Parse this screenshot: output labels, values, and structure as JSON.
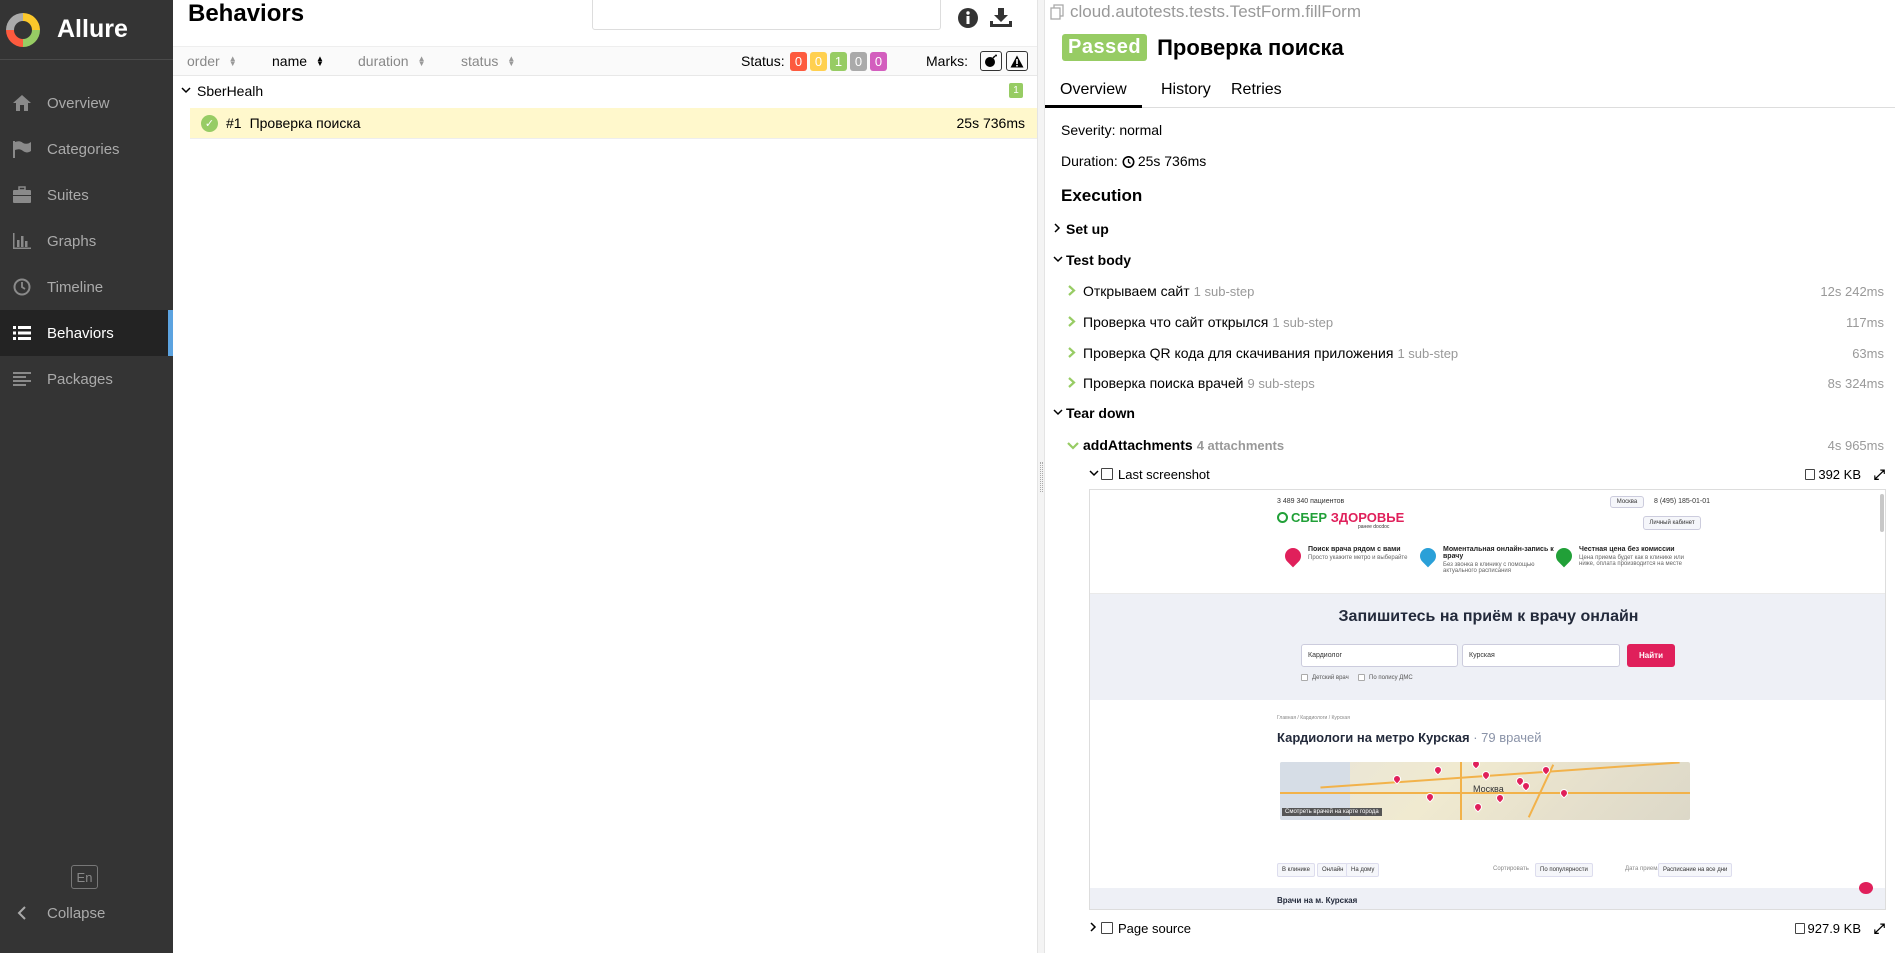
{
  "sidebar": {
    "brand": "Allure",
    "items": [
      {
        "label": "Overview",
        "icon": "home-icon"
      },
      {
        "label": "Categories",
        "icon": "flag-icon"
      },
      {
        "label": "Suites",
        "icon": "briefcase-icon"
      },
      {
        "label": "Graphs",
        "icon": "bar-chart-icon"
      },
      {
        "label": "Timeline",
        "icon": "clock-icon"
      },
      {
        "label": "Behaviors",
        "icon": "list-icon",
        "active": true
      },
      {
        "label": "Packages",
        "icon": "align-left-icon"
      }
    ],
    "lang": "En",
    "collapse": "Collapse"
  },
  "left": {
    "title": "Behaviors",
    "sort": {
      "order": "order",
      "name": "name",
      "duration": "duration",
      "status": "status"
    },
    "status_label": "Status:",
    "status_counts": [
      {
        "value": "0",
        "color": "#fd5a3e"
      },
      {
        "value": "0",
        "color": "#ffd050"
      },
      {
        "value": "1",
        "color": "#97cc64"
      },
      {
        "value": "0",
        "color": "#aaaaaa"
      },
      {
        "value": "0",
        "color": "#d35ebe"
      }
    ],
    "marks_label": "Marks:",
    "group": {
      "label": "SberHealh",
      "count": "1"
    },
    "test": {
      "number": "#1",
      "title": "Проверка поиска",
      "duration": "25s 736ms"
    }
  },
  "right": {
    "fullname": "cloud.autotests.tests.TestForm.fillForm",
    "status": "Passed",
    "title": "Проверка поиска",
    "tabs": [
      "Overview",
      "History",
      "Retries"
    ],
    "severity": "Severity: normal",
    "duration_label": "Duration:",
    "duration": "25s 736ms",
    "execution": "Execution",
    "setup": "Set up",
    "test_body": "Test body",
    "steps": [
      {
        "name": "Открываем сайт",
        "sub": "1 sub-step",
        "duration": "12s 242ms"
      },
      {
        "name": "Проверка что сайт открылся",
        "sub": "1 sub-step",
        "duration": "117ms"
      },
      {
        "name": "Проверка QR кода для скачивания приложения",
        "sub": "1 sub-step",
        "duration": "63ms"
      },
      {
        "name": "Проверка поиска врачей",
        "sub": "9 sub-steps",
        "duration": "8s 324ms"
      }
    ],
    "teardown": "Tear down",
    "teardown_step": {
      "name": "addAttachments",
      "sub": "4 attachments",
      "duration": "4s 965ms"
    },
    "attachments": [
      {
        "name": "Last screenshot",
        "size": "392 KB"
      },
      {
        "name": "Page source",
        "size": "927.9 KB"
      }
    ]
  },
  "screenshot": {
    "patients": "3 489 340 пациентов",
    "brand_a": "СБЕР",
    "brand_b": "ЗДОРОВЬЕ",
    "brand_sub": "ранее docdoc",
    "city": "Москва",
    "phone": "8 (495) 185-01-01",
    "cabinet": "Личный кабинет",
    "features": [
      {
        "title": "Поиск врача рядом с вами",
        "desc": "Просто укажите метро и выберайте"
      },
      {
        "title": "Моментальная онлайн-запись к врачу",
        "desc": "Без звонка в клинику с помощью актуального расписания"
      },
      {
        "title": "Честная цена без комиссии",
        "desc": "Цена приема будет как в клинике или ниже, оплата производится на месте"
      }
    ],
    "hero": "Запишитесь на приём к врачу онлайн",
    "specialty": "Кардиолог",
    "metro": "Курская",
    "find": "Найти",
    "check1": "Детский врач",
    "check2": "По полису ДМС",
    "crumbs": "Главная / Кардиологи / Курская",
    "h2": "Кардиологи на метро Курская",
    "h2_count": "· 79 врачей",
    "map_city": "Москва",
    "map_caption": "Смотреть врачей на карте города",
    "filters": [
      "В клинике",
      "Онлайн",
      "На дому"
    ],
    "sort_label": "Сортировать",
    "sort_value": "По популярности",
    "date_label": "Дата приема",
    "date_value": "Расписание на все дни",
    "bottom": "Врачи на м. Курская"
  }
}
